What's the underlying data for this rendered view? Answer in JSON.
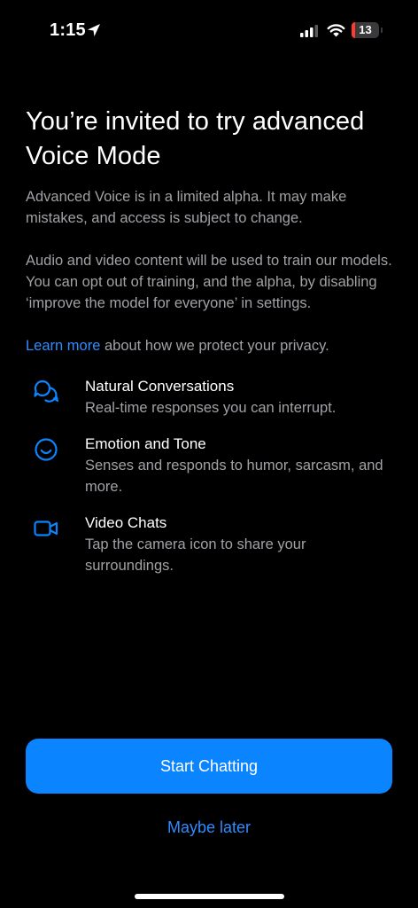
{
  "status_bar": {
    "time": "1:15",
    "battery_level": "13",
    "battery_fraction": 0.13,
    "battery_color": "#ff3b30",
    "icons": [
      "location-arrow-icon",
      "cellular-signal-icon",
      "wifi-icon",
      "battery-icon"
    ]
  },
  "title": "You’re invited to try advanced Voice Mode",
  "paragraph_1": "Advanced Voice is in a limited alpha. It may make mistakes, and access is subject to change.",
  "paragraph_2": "Audio and video content will be used to train our models. You can opt out of training, and the alpha, by disabling ‘improve the model for everyone’ in settings.",
  "privacy": {
    "link_text": "Learn more",
    "rest": " about how we protect your privacy."
  },
  "features": [
    {
      "icon": "chat-bubbles-icon",
      "title": "Natural Conversations",
      "description": "Real-time responses you can interrupt."
    },
    {
      "icon": "smiley-face-icon",
      "title": "Emotion and Tone",
      "description": "Senses and responds to humor, sarcasm, and more."
    },
    {
      "icon": "video-camera-icon",
      "title": "Video Chats",
      "description": "Tap the camera icon to share your surroundings."
    }
  ],
  "buttons": {
    "start": "Start Chatting",
    "later": "Maybe later"
  },
  "colors": {
    "accent": "#0a84ff",
    "link": "#2f8cff",
    "background": "#000000",
    "secondary_text": "#a1a1a6"
  }
}
